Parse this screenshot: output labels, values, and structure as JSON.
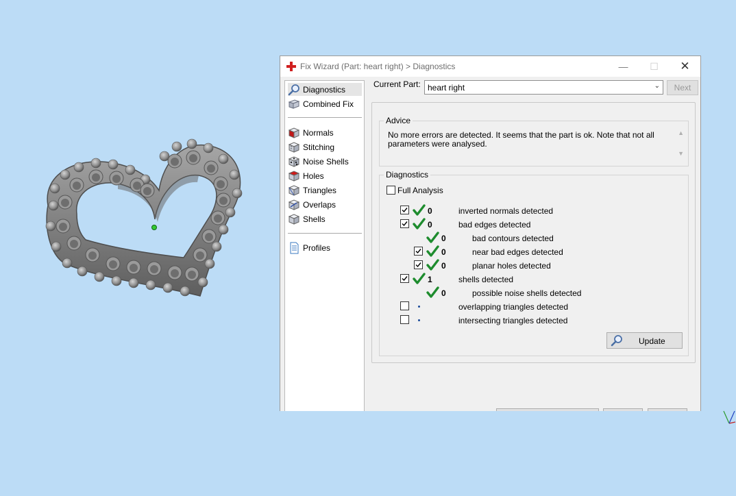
{
  "window": {
    "title": "Fix Wizard (Part: heart right) > Diagnostics",
    "controls": {
      "minimize": "—",
      "maximize": "☐",
      "close": "✕"
    }
  },
  "nav": {
    "items": [
      {
        "label": "Diagnostics",
        "icon": "magnifier-icon",
        "selected": true
      },
      {
        "label": "Combined Fix",
        "icon": "combined-fix-icon"
      },
      {
        "label": "Normals",
        "icon": "normals-cube-icon"
      },
      {
        "label": "Stitching",
        "icon": "stitching-cube-icon"
      },
      {
        "label": "Noise Shells",
        "icon": "noise-shells-cube-icon"
      },
      {
        "label": "Holes",
        "icon": "holes-cube-icon"
      },
      {
        "label": "Triangles",
        "icon": "triangles-cube-icon"
      },
      {
        "label": "Overlaps",
        "icon": "overlaps-cube-icon"
      },
      {
        "label": "Shells",
        "icon": "shells-cube-icon"
      },
      {
        "label": "Profiles",
        "icon": "document-icon"
      }
    ]
  },
  "current_part": {
    "label": "Current Part:",
    "value": "heart right"
  },
  "next_button": "Next",
  "advice": {
    "title": "Advice",
    "text": "No more errors are detected. It seems that the part is ok. Note that not all parameters were analysed."
  },
  "diagnostics": {
    "title": "Diagnostics",
    "full_analysis": {
      "label": "Full Analysis",
      "checked": false
    },
    "rows": [
      {
        "checked": true,
        "status": "ok",
        "count": "0",
        "label": "inverted normals detected"
      },
      {
        "checked": true,
        "status": "ok",
        "count": "0",
        "label": "bad edges detected"
      },
      {
        "status": "ok",
        "count": "0",
        "label": "bad contours detected"
      },
      {
        "checked": true,
        "status": "ok",
        "count": "0",
        "label": "near bad edges detected"
      },
      {
        "checked": true,
        "status": "ok",
        "count": "0",
        "label": "planar holes detected"
      },
      {
        "checked": true,
        "status": "ok",
        "count": "1",
        "label": "shells detected"
      },
      {
        "status": "ok",
        "count": "0",
        "label": "possible noise shells detected"
      },
      {
        "checked": false,
        "status": "not-analysed",
        "count": "",
        "label": "overlapping triangles detected"
      },
      {
        "checked": false,
        "status": "not-analysed",
        "count": "",
        "label": "intersecting triangles detected"
      }
    ],
    "update_button": "Update"
  },
  "colors": {
    "viewport_background": "#bcdcf6",
    "check_green": "#1e8c2e",
    "model_gray": "#8a8a8a"
  }
}
